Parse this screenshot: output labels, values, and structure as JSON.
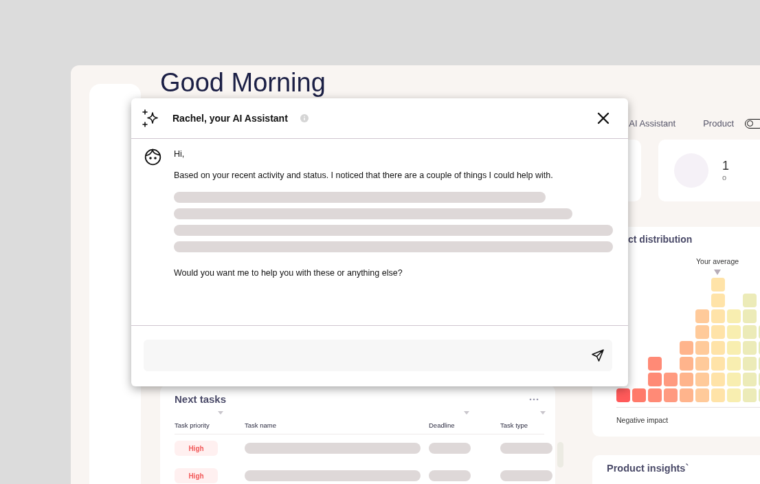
{
  "greeting": "Good Morning",
  "nav": [
    {
      "label": "AI Assistant"
    },
    {
      "label": "Product"
    }
  ],
  "product_toggle": {
    "on": false
  },
  "stat_card": {
    "value": "1",
    "caption": "o"
  },
  "distribution": {
    "title": "ct distribution",
    "marker_label": "Your average",
    "axis_label": "Negative impact"
  },
  "insights": {
    "title": "Product insights`"
  },
  "tasks": {
    "title": "Next tasks",
    "columns": [
      {
        "label": "Task priority",
        "sortable": true
      },
      {
        "label": "Task name",
        "sortable": false
      },
      {
        "label": "Deadline",
        "sortable": true
      },
      {
        "label": "Task type",
        "sortable": true
      }
    ],
    "rows": [
      {
        "priority": "High"
      },
      {
        "priority": "High"
      }
    ]
  },
  "assistant": {
    "title": "Rachel, your AI Assistant",
    "messages": [
      {
        "kind": "text",
        "text": "Hi,"
      },
      {
        "kind": "text",
        "text": "Based on your recent activity and status. I noticed that there are a couple of things I could help with."
      },
      {
        "kind": "placeholder_lines"
      },
      {
        "kind": "text",
        "text": "Would you want me to help you with these or anything else?"
      }
    ]
  }
}
